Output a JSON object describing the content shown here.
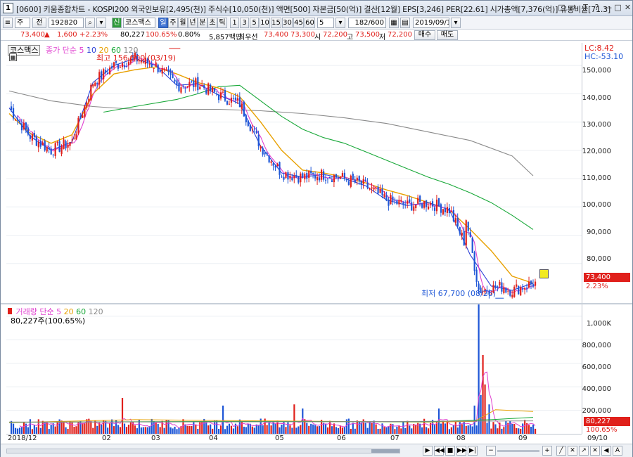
{
  "window": {
    "title": "[0600] 키움종합차트 - KOSPI200 외국인보유[2,495(천)] 주식수[10,050(천)] 액면[500] 자본금[50(억)] 결산[12월] EPS[3,246] PER[22.61] 시가총액[7,376(억)] 유통비율[71.3]",
    "app_icon": "1",
    "controls": [
      "□",
      "⇄",
      "T",
      "?",
      "—",
      "□",
      "✕"
    ]
  },
  "toolbar": {
    "period_label": "주",
    "prev_label": "전",
    "stock_code": "192820",
    "stock_name": "코스맥스",
    "badge": "신",
    "interval_buttons": [
      "일",
      "주",
      "월",
      "년",
      "분",
      "초",
      "틱"
    ],
    "minute_buttons": [
      "1",
      "3",
      "5",
      "10",
      "15",
      "30",
      "45",
      "60"
    ],
    "count_value": "5",
    "range_value": "182/600",
    "date_value": "2019/09/10"
  },
  "quote": {
    "price": "73,400",
    "arrow": "▲",
    "change": "1,600",
    "change_pct": "+2.23%",
    "volume": "80,227",
    "vol_ratio": "100.65%",
    "turnover": "0.80%",
    "amount": "5,857백만",
    "best_bid_label": "최우선",
    "best_ask": "73,400",
    "best_bid": "73,300",
    "open_label": "시",
    "open": "72,200",
    "high_label": "고",
    "high": "73,500",
    "low_label": "저",
    "low": "72,200",
    "buy_label": "매수",
    "sell_label": "매도"
  },
  "price_pane": {
    "legend_stock": "코스맥스",
    "legend_ma_head": "종가 단순",
    "ma_periods": [
      "5",
      "10",
      "20",
      "60",
      "120"
    ],
    "max_label": "최고 156,500 (03/19)",
    "min_label": "최저 67,700 (08/26)",
    "lc_label": "LC:8.42",
    "hc_label": "HC:-53.10",
    "last_price_tag": "73,400",
    "last_pct_tag": "2.23%"
  },
  "volume_pane": {
    "legend_head": "거래량 단순",
    "ma_periods": [
      "5",
      "20",
      "60",
      "120"
    ],
    "subtitle": "80,227주(100.65%)",
    "last_vol_tag": "80,227",
    "last_pct_tag": "100.65%"
  },
  "colors": {
    "up": "#e0201b",
    "down": "#1e56d6",
    "ma5": "#e040d0",
    "ma10": "#2b3fd6",
    "ma20": "#e8a000",
    "ma60": "#18a838",
    "ma120": "#8a8a8a"
  },
  "chart_data": {
    "type": "candlestick",
    "price_ylim": [
      66000,
      158000
    ],
    "price_ticks": [
      "150,000",
      "140,000",
      "130,000",
      "120,000",
      "110,000",
      "100,000",
      "90,000",
      "80,000"
    ],
    "volume_ylim": [
      0,
      1100000
    ],
    "volume_ticks": [
      "1,000K",
      "800,000",
      "600,000",
      "400,000",
      "200,000"
    ],
    "x_labels": [
      "2018/12",
      "02",
      "03",
      "04",
      "05",
      "06",
      "07",
      "08",
      "09",
      "09/10"
    ],
    "ma20_path": [
      [
        0,
        133000
      ],
      [
        10,
        126000
      ],
      [
        20,
        122500
      ],
      [
        30,
        125500
      ],
      [
        40,
        140000
      ],
      [
        50,
        147000
      ],
      [
        60,
        148500
      ],
      [
        70,
        149500
      ],
      [
        80,
        147000
      ],
      [
        90,
        144000
      ],
      [
        100,
        142000
      ],
      [
        110,
        139000
      ],
      [
        120,
        130000
      ],
      [
        130,
        120000
      ],
      [
        140,
        113000
      ],
      [
        150,
        112000
      ],
      [
        160,
        110500
      ],
      [
        170,
        108500
      ],
      [
        180,
        106000
      ],
      [
        190,
        104000
      ],
      [
        200,
        101500
      ],
      [
        210,
        99000
      ],
      [
        220,
        92000
      ],
      [
        230,
        84500
      ],
      [
        240,
        75500
      ],
      [
        250,
        73000
      ]
    ],
    "ma60_path": [
      [
        45,
        133500
      ],
      [
        60,
        135500
      ],
      [
        80,
        138000
      ],
      [
        90,
        140000
      ],
      [
        100,
        142500
      ],
      [
        110,
        143000
      ],
      [
        120,
        137500
      ],
      [
        130,
        132000
      ],
      [
        140,
        127500
      ],
      [
        150,
        124500
      ],
      [
        160,
        122500
      ],
      [
        170,
        119500
      ],
      [
        180,
        116500
      ],
      [
        190,
        113500
      ],
      [
        200,
        110500
      ],
      [
        210,
        108000
      ],
      [
        220,
        105000
      ],
      [
        230,
        101500
      ],
      [
        240,
        97000
      ],
      [
        250,
        92000
      ]
    ],
    "ma120_path": [
      [
        0,
        141000
      ],
      [
        20,
        137500
      ],
      [
        40,
        135500
      ],
      [
        60,
        134500
      ],
      [
        80,
        134500
      ],
      [
        100,
        134500
      ],
      [
        120,
        134000
      ],
      [
        140,
        133000
      ],
      [
        160,
        131500
      ],
      [
        180,
        129500
      ],
      [
        200,
        126500
      ],
      [
        220,
        123500
      ],
      [
        240,
        118000
      ],
      [
        250,
        111000
      ]
    ],
    "ma10_path": [
      [
        0,
        135000
      ],
      [
        10,
        125000
      ],
      [
        20,
        120000
      ],
      [
        30,
        123000
      ],
      [
        40,
        144000
      ],
      [
        50,
        150000
      ],
      [
        60,
        152500
      ],
      [
        70,
        150000
      ],
      [
        80,
        143000
      ],
      [
        90,
        143500
      ],
      [
        100,
        139500
      ],
      [
        110,
        136500
      ],
      [
        120,
        121500
      ],
      [
        130,
        112000
      ],
      [
        140,
        110500
      ],
      [
        150,
        111500
      ],
      [
        160,
        110000
      ],
      [
        170,
        107500
      ],
      [
        180,
        102500
      ],
      [
        190,
        100500
      ],
      [
        200,
        101500
      ],
      [
        210,
        99000
      ],
      [
        220,
        83000
      ],
      [
        230,
        72000
      ],
      [
        240,
        70500
      ],
      [
        250,
        73000
      ]
    ]
  }
}
